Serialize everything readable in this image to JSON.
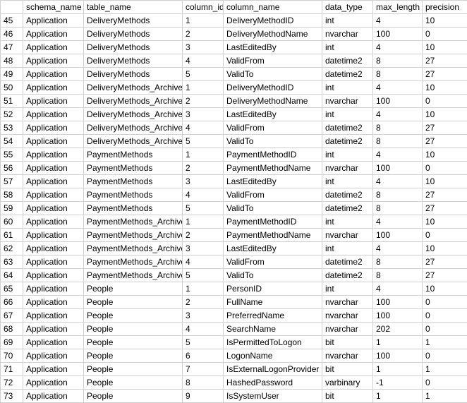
{
  "headers": {
    "row": "",
    "schema_name": "schema_name",
    "table_name": "table_name",
    "column_id": "column_id",
    "column_name": "column_name",
    "data_type": "data_type",
    "max_length": "max_length",
    "precision": "precision"
  },
  "rows": [
    {
      "n": "45",
      "schema": "Application",
      "table": "DeliveryMethods",
      "colid": "1",
      "colname": "DeliveryMethodID",
      "dtype": "int",
      "maxlen": "4",
      "prec": "10"
    },
    {
      "n": "46",
      "schema": "Application",
      "table": "DeliveryMethods",
      "colid": "2",
      "colname": "DeliveryMethodName",
      "dtype": "nvarchar",
      "maxlen": "100",
      "prec": "0"
    },
    {
      "n": "47",
      "schema": "Application",
      "table": "DeliveryMethods",
      "colid": "3",
      "colname": "LastEditedBy",
      "dtype": "int",
      "maxlen": "4",
      "prec": "10"
    },
    {
      "n": "48",
      "schema": "Application",
      "table": "DeliveryMethods",
      "colid": "4",
      "colname": "ValidFrom",
      "dtype": "datetime2",
      "maxlen": "8",
      "prec": "27"
    },
    {
      "n": "49",
      "schema": "Application",
      "table": "DeliveryMethods",
      "colid": "5",
      "colname": "ValidTo",
      "dtype": "datetime2",
      "maxlen": "8",
      "prec": "27"
    },
    {
      "n": "50",
      "schema": "Application",
      "table": "DeliveryMethods_Archive",
      "colid": "1",
      "colname": "DeliveryMethodID",
      "dtype": "int",
      "maxlen": "4",
      "prec": "10"
    },
    {
      "n": "51",
      "schema": "Application",
      "table": "DeliveryMethods_Archive",
      "colid": "2",
      "colname": "DeliveryMethodName",
      "dtype": "nvarchar",
      "maxlen": "100",
      "prec": "0"
    },
    {
      "n": "52",
      "schema": "Application",
      "table": "DeliveryMethods_Archive",
      "colid": "3",
      "colname": "LastEditedBy",
      "dtype": "int",
      "maxlen": "4",
      "prec": "10"
    },
    {
      "n": "53",
      "schema": "Application",
      "table": "DeliveryMethods_Archive",
      "colid": "4",
      "colname": "ValidFrom",
      "dtype": "datetime2",
      "maxlen": "8",
      "prec": "27"
    },
    {
      "n": "54",
      "schema": "Application",
      "table": "DeliveryMethods_Archive",
      "colid": "5",
      "colname": "ValidTo",
      "dtype": "datetime2",
      "maxlen": "8",
      "prec": "27"
    },
    {
      "n": "55",
      "schema": "Application",
      "table": "PaymentMethods",
      "colid": "1",
      "colname": "PaymentMethodID",
      "dtype": "int",
      "maxlen": "4",
      "prec": "10"
    },
    {
      "n": "56",
      "schema": "Application",
      "table": "PaymentMethods",
      "colid": "2",
      "colname": "PaymentMethodName",
      "dtype": "nvarchar",
      "maxlen": "100",
      "prec": "0"
    },
    {
      "n": "57",
      "schema": "Application",
      "table": "PaymentMethods",
      "colid": "3",
      "colname": "LastEditedBy",
      "dtype": "int",
      "maxlen": "4",
      "prec": "10"
    },
    {
      "n": "58",
      "schema": "Application",
      "table": "PaymentMethods",
      "colid": "4",
      "colname": "ValidFrom",
      "dtype": "datetime2",
      "maxlen": "8",
      "prec": "27"
    },
    {
      "n": "59",
      "schema": "Application",
      "table": "PaymentMethods",
      "colid": "5",
      "colname": "ValidTo",
      "dtype": "datetime2",
      "maxlen": "8",
      "prec": "27"
    },
    {
      "n": "60",
      "schema": "Application",
      "table": "PaymentMethods_Archive",
      "colid": "1",
      "colname": "PaymentMethodID",
      "dtype": "int",
      "maxlen": "4",
      "prec": "10"
    },
    {
      "n": "61",
      "schema": "Application",
      "table": "PaymentMethods_Archive",
      "colid": "2",
      "colname": "PaymentMethodName",
      "dtype": "nvarchar",
      "maxlen": "100",
      "prec": "0"
    },
    {
      "n": "62",
      "schema": "Application",
      "table": "PaymentMethods_Archive",
      "colid": "3",
      "colname": "LastEditedBy",
      "dtype": "int",
      "maxlen": "4",
      "prec": "10"
    },
    {
      "n": "63",
      "schema": "Application",
      "table": "PaymentMethods_Archive",
      "colid": "4",
      "colname": "ValidFrom",
      "dtype": "datetime2",
      "maxlen": "8",
      "prec": "27"
    },
    {
      "n": "64",
      "schema": "Application",
      "table": "PaymentMethods_Archive",
      "colid": "5",
      "colname": "ValidTo",
      "dtype": "datetime2",
      "maxlen": "8",
      "prec": "27"
    },
    {
      "n": "65",
      "schema": "Application",
      "table": "People",
      "colid": "1",
      "colname": "PersonID",
      "dtype": "int",
      "maxlen": "4",
      "prec": "10"
    },
    {
      "n": "66",
      "schema": "Application",
      "table": "People",
      "colid": "2",
      "colname": "FullName",
      "dtype": "nvarchar",
      "maxlen": "100",
      "prec": "0"
    },
    {
      "n": "67",
      "schema": "Application",
      "table": "People",
      "colid": "3",
      "colname": "PreferredName",
      "dtype": "nvarchar",
      "maxlen": "100",
      "prec": "0"
    },
    {
      "n": "68",
      "schema": "Application",
      "table": "People",
      "colid": "4",
      "colname": "SearchName",
      "dtype": "nvarchar",
      "maxlen": "202",
      "prec": "0"
    },
    {
      "n": "69",
      "schema": "Application",
      "table": "People",
      "colid": "5",
      "colname": "IsPermittedToLogon",
      "dtype": "bit",
      "maxlen": "1",
      "prec": "1"
    },
    {
      "n": "70",
      "schema": "Application",
      "table": "People",
      "colid": "6",
      "colname": "LogonName",
      "dtype": "nvarchar",
      "maxlen": "100",
      "prec": "0"
    },
    {
      "n": "71",
      "schema": "Application",
      "table": "People",
      "colid": "7",
      "colname": "IsExternalLogonProvider",
      "dtype": "bit",
      "maxlen": "1",
      "prec": "1"
    },
    {
      "n": "72",
      "schema": "Application",
      "table": "People",
      "colid": "8",
      "colname": "HashedPassword",
      "dtype": "varbinary",
      "maxlen": "-1",
      "prec": "0"
    },
    {
      "n": "73",
      "schema": "Application",
      "table": "People",
      "colid": "9",
      "colname": "IsSystemUser",
      "dtype": "bit",
      "maxlen": "1",
      "prec": "1"
    }
  ]
}
